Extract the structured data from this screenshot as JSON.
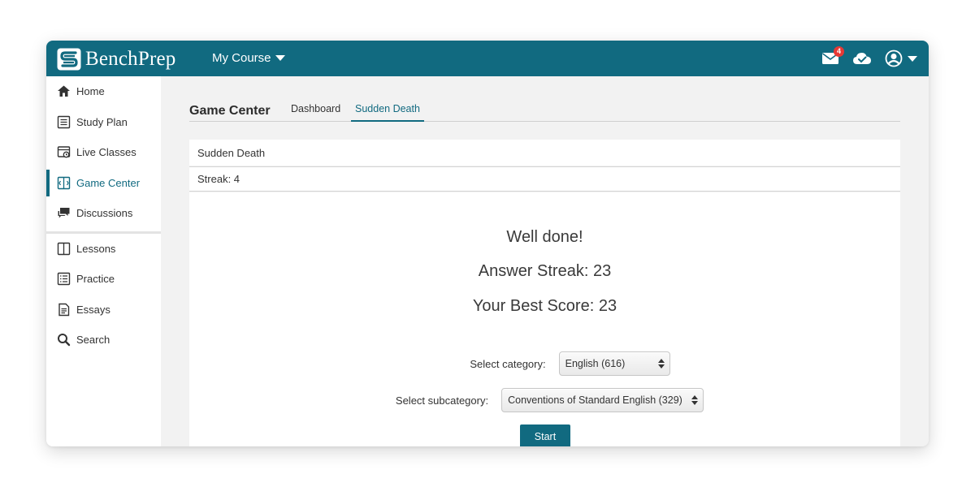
{
  "app": {
    "brand": "BenchPrep",
    "accent_color": "#116a80"
  },
  "header": {
    "course_menu_label": "My Course",
    "notifications_count": "4",
    "icons": [
      "mail-icon",
      "cloud-check-icon",
      "account-icon"
    ]
  },
  "sidebar": {
    "items": [
      {
        "label": "Home",
        "icon": "home-icon"
      },
      {
        "label": "Study Plan",
        "icon": "study-plan-icon"
      },
      {
        "label": "Live Classes",
        "icon": "live-classes-icon"
      },
      {
        "label": "Game Center",
        "icon": "game-center-icon",
        "active": true
      },
      {
        "label": "Discussions",
        "icon": "discussions-icon"
      },
      {
        "label": "Lessons",
        "icon": "lessons-icon"
      },
      {
        "label": "Practice",
        "icon": "practice-icon"
      },
      {
        "label": "Essays",
        "icon": "essays-icon"
      },
      {
        "label": "Search",
        "icon": "search-icon"
      }
    ]
  },
  "main": {
    "title": "Game Center",
    "tabs": [
      {
        "label": "Dashboard"
      },
      {
        "label": "Sudden Death",
        "active": true
      }
    ],
    "panel_title": "Sudden Death",
    "streak_text": "Streak: 4",
    "result": {
      "message": "Well done!",
      "answer_streak": "Answer Streak: 23",
      "best_score": "Your Best Score: 23"
    },
    "form": {
      "category_label": "Select category:",
      "category_value": "English (616)",
      "subcategory_label": "Select subcategory:",
      "subcategory_value": "Conventions of Standard English (329)",
      "start_label": "Start"
    }
  }
}
